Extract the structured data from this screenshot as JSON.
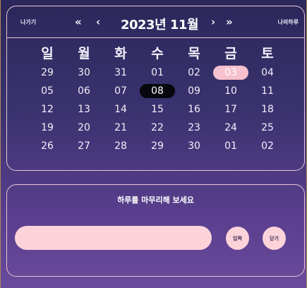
{
  "calendar": {
    "prev_label": "나가기",
    "next_label": "나의하루",
    "nav": {
      "prev_year": "«",
      "prev_month": "‹",
      "next_month": "›",
      "next_year": "»"
    },
    "title": "2023년 11월",
    "weekdays": [
      "일",
      "월",
      "화",
      "수",
      "목",
      "금",
      "토"
    ],
    "weeks": [
      [
        "29",
        "30",
        "31",
        "01",
        "02",
        "03",
        "04"
      ],
      [
        "05",
        "06",
        "07",
        "08",
        "09",
        "10",
        "11"
      ],
      [
        "12",
        "13",
        "14",
        "15",
        "16",
        "17",
        "18"
      ],
      [
        "19",
        "20",
        "21",
        "22",
        "23",
        "24",
        "25"
      ],
      [
        "26",
        "27",
        "28",
        "29",
        "30",
        "01",
        "02"
      ]
    ],
    "highlight_today": "03",
    "highlight_selected": "08"
  },
  "diary": {
    "prompt": "하루를 마무리해 보세요",
    "input_value": "",
    "enter_label": "입력",
    "close_label": "닫기"
  },
  "colors": {
    "today": "#f7c1cf",
    "selected": "#07070e",
    "border": "#e9c6d8",
    "input_bg": "#fdd3da"
  }
}
